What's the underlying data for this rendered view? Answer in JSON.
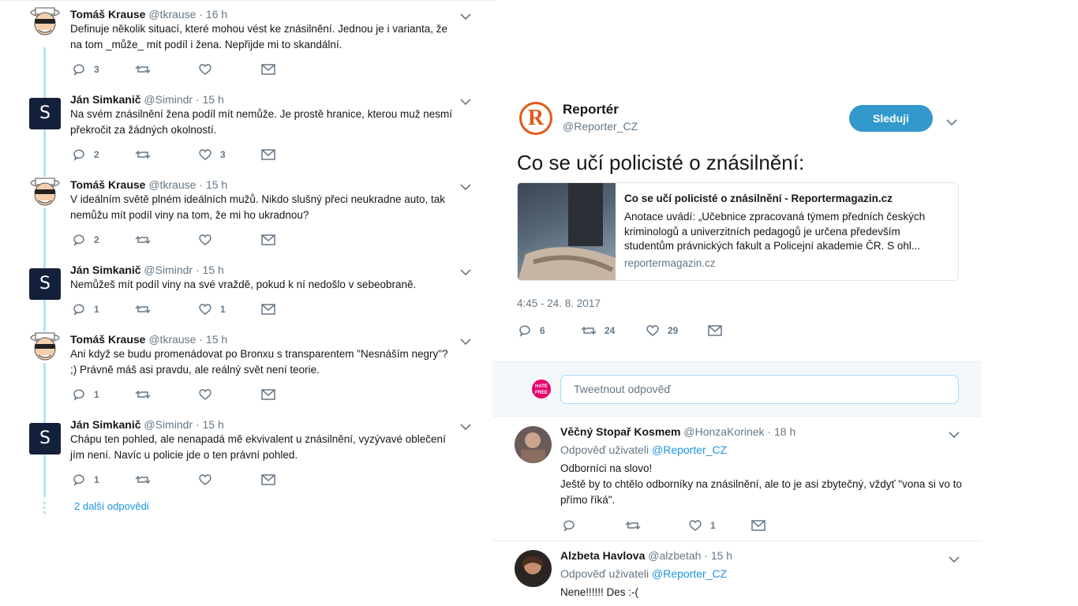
{
  "conversation": {
    "tweets": [
      {
        "name": "Tomáš Krause",
        "handle": "@tkrause · 16 h",
        "avatar": "cartoon-avatar",
        "text": "Definuje několik situací, které mohou vést ke znásilnění. Jednou je i varianta, že na tom _může_ mít podíl i žena. Nepřijde mi to skandální.",
        "replies": "3",
        "retweets": "",
        "likes": ""
      },
      {
        "name": "Ján Simkanič",
        "handle": "@Simindr · 15 h",
        "avatar": "S",
        "text": "Na svém znásilnění žena podíl mít nemůže. Je prostě hranice, kterou muž nesmí překročit za žádných okolností.",
        "replies": "2",
        "retweets": "",
        "likes": "3"
      },
      {
        "name": "Tomáš Krause",
        "handle": "@tkrause · 15 h",
        "avatar": "cartoon-avatar",
        "text": "V ideálním světě plném ideálních mužů. Nikdo slušný přeci neukradne auto, tak nemůžu mít podíl viny na tom, že mi ho ukradnou?",
        "replies": "2",
        "retweets": "",
        "likes": ""
      },
      {
        "name": "Ján Simkanič",
        "handle": "@Simindr · 15 h",
        "avatar": "S",
        "text": "Nemůžeš mít podíl viny na své vraždě, pokud k ní nedošlo v sebeobraně.",
        "replies": "1",
        "retweets": "",
        "likes": "1"
      },
      {
        "name": "Tomáš Krause",
        "handle": "@tkrause · 15 h",
        "avatar": "cartoon-avatar",
        "text": "Ani když se budu promenádovat po Bronxu s transparentem \"Nesnáším negry\"? ;)  Právně máš asi pravdu, ale reálný svět není teorie.",
        "replies": "1",
        "retweets": "",
        "likes": ""
      },
      {
        "name": "Ján Simkanič",
        "handle": "@Simindr · 15 h",
        "avatar": "S",
        "text": "Chápu ten pohled, ale nenapadá mě ekvivalent u znásilnění, vyzývavé oblečení jím není. Navíc u policie jde o ten právní pohled.",
        "replies": "1",
        "retweets": "",
        "likes": ""
      }
    ],
    "more_replies": "2 další odpovědi"
  },
  "main_tweet": {
    "name": "Reportér",
    "handle": "@Reporter_CZ",
    "logo_letter": "R",
    "follow_label": "Sleduji",
    "text": "Co se učí policisté o znásilnění:",
    "card": {
      "title": "Co se učí policisté o znásilnění - Reportermagazin.cz",
      "description": "Anotace uvádí: „Učebnice zpracovaná týmem předních českých kriminologů a univerzitních pedagogů je určena především studentům právnických fakult a Policejní akademie ČR. S ohl...",
      "domain": "reportermagazin.cz"
    },
    "timestamp": "4:45 - 24. 8. 2017",
    "replies": "6",
    "retweets": "24",
    "likes": "29"
  },
  "reply_box": {
    "placeholder": "Tweetnout odpověď",
    "avatar_text": "HATE FREE"
  },
  "replies": [
    {
      "name": "Věčný Stopař Kosmem",
      "handle": "@HonzaKorinek · 18 h",
      "reply_to_prefix": "Odpověď uživateli",
      "reply_to": "@Reporter_CZ",
      "text_line1": "Odborníci na slovo!",
      "text_line2": "Ještě by to chtělo odborníky na znásilnění, ale to je asi zbytečný, vždyť \"vona si vo to přímo říká\".",
      "replies": "",
      "retweets": "",
      "likes": "1"
    },
    {
      "name": "Alzbeta Havlova",
      "handle": "@alzbetah · 15 h",
      "reply_to_prefix": "Odpověď uživateli",
      "reply_to": "@Reporter_CZ",
      "text_line1": "Nene!!!!!! Des :-(",
      "text_line2": "",
      "replies": "",
      "retweets": "",
      "likes": ""
    }
  ],
  "colors": {
    "accent": "#1b95e0",
    "follow_button": "#3399cc",
    "thread_line": "#b4e3f8",
    "brand_logo": "#e05a1b"
  }
}
